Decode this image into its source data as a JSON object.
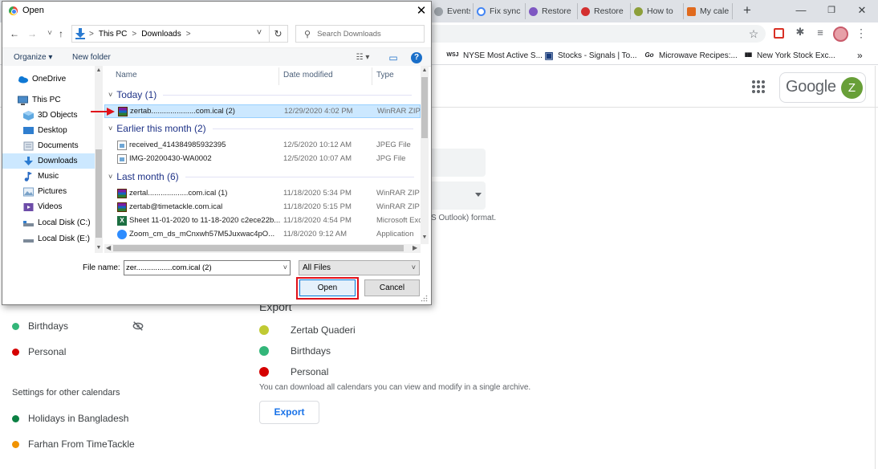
{
  "browser": {
    "tabs": [
      {
        "label": "Events",
        "color": "#5f6368"
      },
      {
        "label": "Fix sync",
        "color": "#4285f4"
      },
      {
        "label": "Restore",
        "color": "#7e57c2"
      },
      {
        "label": "Restore",
        "color": "#d32f2f"
      },
      {
        "label": "How to",
        "color": "#8d9f3a"
      },
      {
        "label": "My cale",
        "color": "#e06a1e"
      }
    ],
    "new_tab": "+",
    "window_controls": {
      "minimize": "—",
      "restore": "❐",
      "close": "✕"
    },
    "toolbar_icons": {
      "star": "☆",
      "extension1": "🛡",
      "puzzle": "✱",
      "playlist": "≡",
      "menu": "⋮"
    },
    "bookmarks": [
      {
        "icon": "WSJ",
        "label": "NYSE Most Active S..."
      },
      {
        "icon": "▣",
        "label": "Stocks - Signals | To..."
      },
      {
        "icon": "Go",
        "label": "Microwave Recipes:..."
      },
      {
        "icon": "▮▮▮",
        "label": "New York Stock Exc..."
      }
    ],
    "bookmarks_overflow": "»"
  },
  "calendar": {
    "google_word": "Google",
    "avatar_letter": "Z",
    "format_text": "S Outlook) format.",
    "export_heading": "Export",
    "export_calendars": [
      {
        "label": "Zertab Quaderi",
        "color": "#c0ca33"
      },
      {
        "label": "Birthdays",
        "color": "#33b679"
      },
      {
        "label": "Personal",
        "color": "#d50000"
      }
    ],
    "export_note": "You can download all calendars you can view and modify in a single archive.",
    "export_button": "Export",
    "my_calendars": [
      {
        "label": "Birthdays",
        "color": "#33b679"
      },
      {
        "label": "Personal",
        "color": "#d50000"
      }
    ],
    "other_calendars_title": "Settings for other calendars",
    "other_calendars": [
      {
        "label": "Holidays in Bangladesh",
        "color": "#0b8043"
      },
      {
        "label": "Farhan From TimeTackle",
        "color": "#f09300"
      }
    ]
  },
  "dialog": {
    "title": "Open",
    "close": "✕",
    "nav": {
      "back": "←",
      "forward": "→",
      "recent": "˅",
      "up": "↑"
    },
    "breadcrumb": [
      "This PC",
      "Downloads"
    ],
    "breadcrumb_sep": ">",
    "refresh": "↻",
    "search_placeholder": "Search Downloads",
    "commands": {
      "organize": "Organize ▾",
      "new_folder": "New folder",
      "view": "☷ ▾",
      "preview": "▭",
      "help": "?"
    },
    "nav_pane": [
      {
        "label": "OneDrive",
        "color": "#0f78d4",
        "selected": false
      },
      {
        "label": "This PC",
        "color": "#4a8bc9",
        "selected": false
      },
      {
        "label": "3D Objects",
        "color": "#5fa8e0",
        "selected": false
      },
      {
        "label": "Desktop",
        "color": "#2f7ecf",
        "selected": false
      },
      {
        "label": "Documents",
        "color": "#8a9bb0",
        "selected": false
      },
      {
        "label": "Downloads",
        "color": "#2b7bd1",
        "selected": true
      },
      {
        "label": "Music",
        "color": "#2b6cc4",
        "selected": false
      },
      {
        "label": "Pictures",
        "color": "#7aa2c8",
        "selected": false
      },
      {
        "label": "Videos",
        "color": "#6d4ca8",
        "selected": false
      },
      {
        "label": "Local Disk (C:)",
        "color": "#7c8a99",
        "selected": false
      },
      {
        "label": "Local Disk (E:)",
        "color": "#7c8a99",
        "selected": false
      }
    ],
    "columns": {
      "name": "Name",
      "date": "Date modified",
      "type": "Type"
    },
    "groups": [
      {
        "title": "Today (1)",
        "files": [
          {
            "name": "zertab.....................com.ical (2)",
            "date": "12/29/2020 4:02 PM",
            "type": "WinRAR ZIP a",
            "icon": "winrar",
            "selected": true
          }
        ]
      },
      {
        "title": "Earlier this month (2)",
        "files": [
          {
            "name": "received_414384985932395",
            "date": "12/5/2020 10:12 AM",
            "type": "JPEG File",
            "icon": "jpeg",
            "selected": false
          },
          {
            "name": "IMG-20200430-WA0002",
            "date": "12/5/2020 10:07 AM",
            "type": "JPG File",
            "icon": "jpeg",
            "selected": false
          }
        ]
      },
      {
        "title": "Last month (6)",
        "files": [
          {
            "name": "zertal...................com.ical (1)",
            "date": "11/18/2020 5:34 PM",
            "type": "WinRAR ZIP a",
            "icon": "winrar",
            "selected": false
          },
          {
            "name": "zertab@timetackle.com.ical",
            "date": "11/18/2020 5:15 PM",
            "type": "WinRAR ZIP a",
            "icon": "winrar",
            "selected": false
          },
          {
            "name": "Sheet 11-01-2020 to 11-18-2020 c2ece22b...",
            "date": "11/18/2020 4:54 PM",
            "type": "Microsoft Exc",
            "icon": "excel",
            "selected": false
          },
          {
            "name": "Zoom_cm_ds_mCnxwh57M5Juxwac4pO...",
            "date": "11/8/2020 9:12 AM",
            "type": "Application",
            "icon": "zoom",
            "selected": false
          }
        ]
      }
    ],
    "file_name_label": "File name:",
    "file_name_value": "zer.................com.ical (2)",
    "filter": "All Files",
    "open_button": "Open",
    "cancel_button": "Cancel",
    "highlight_color": "#e0111a"
  }
}
